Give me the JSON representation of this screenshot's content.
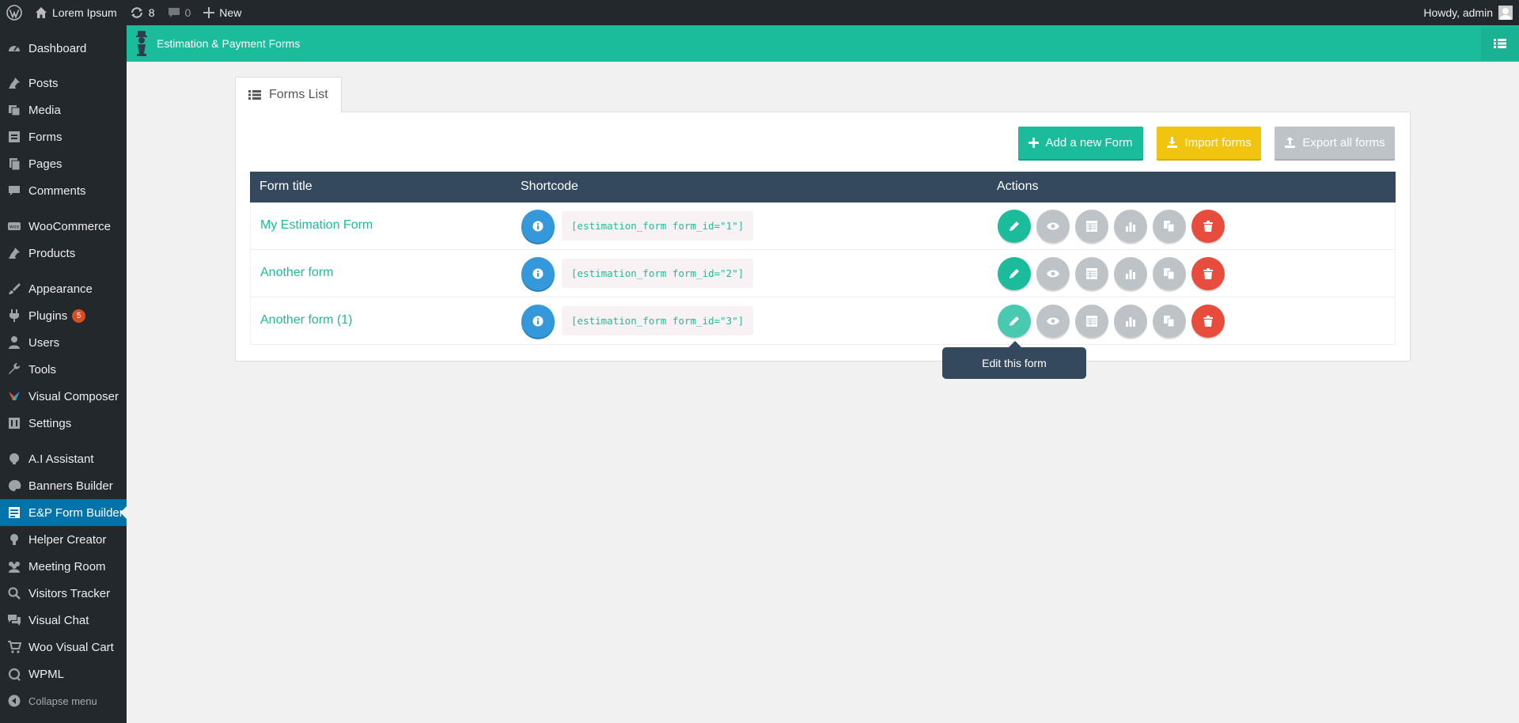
{
  "adminbar": {
    "site_name": "Lorem Ipsum",
    "updates_count": "8",
    "comments_count": "0",
    "new_label": "New",
    "howdy": "Howdy, admin"
  },
  "sidebar": {
    "items": [
      {
        "label": "Dashboard",
        "icon": "dashboard-icon"
      },
      {
        "label": "Posts",
        "icon": "pin-icon"
      },
      {
        "label": "Media",
        "icon": "media-icon"
      },
      {
        "label": "Forms",
        "icon": "forms-icon"
      },
      {
        "label": "Pages",
        "icon": "pages-icon"
      },
      {
        "label": "Comments",
        "icon": "comment-icon"
      },
      {
        "label": "WooCommerce",
        "icon": "woo-icon"
      },
      {
        "label": "Products",
        "icon": "pin-icon"
      },
      {
        "label": "Appearance",
        "icon": "brush-icon"
      },
      {
        "label": "Plugins",
        "icon": "plug-icon",
        "badge": "5"
      },
      {
        "label": "Users",
        "icon": "user-icon"
      },
      {
        "label": "Tools",
        "icon": "wrench-icon"
      },
      {
        "label": "Visual Composer",
        "icon": "vc-icon"
      },
      {
        "label": "Settings",
        "icon": "settings-icon"
      },
      {
        "label": "A.I Assistant",
        "icon": "assistant-icon"
      },
      {
        "label": "Banners Builder",
        "icon": "palette-icon"
      },
      {
        "label": "E&P Form Builder",
        "icon": "form-builder-icon"
      },
      {
        "label": "Helper Creator",
        "icon": "lightbulb-icon"
      },
      {
        "label": "Meeting Room",
        "icon": "group-icon"
      },
      {
        "label": "Visitors Tracker",
        "icon": "search-icon"
      },
      {
        "label": "Visual Chat",
        "icon": "chat-icon"
      },
      {
        "label": "Woo Visual Cart",
        "icon": "cart-icon"
      },
      {
        "label": "WPML",
        "icon": "wpml-icon"
      }
    ],
    "collapse_label": "Collapse menu"
  },
  "plugin": {
    "title": "Estimation & Payment Forms"
  },
  "tab": {
    "label": "Forms List"
  },
  "toolbar": {
    "add_label": "Add a new Form",
    "import_label": "Import forms",
    "export_label": "Export all forms"
  },
  "table": {
    "headers": [
      "Form title",
      "Shortcode",
      "Actions"
    ],
    "rows": [
      {
        "title": "My Estimation Form",
        "shortcode": "[estimation_form form_id=\"1\"]"
      },
      {
        "title": "Another form",
        "shortcode": "[estimation_form form_id=\"2\"]"
      },
      {
        "title": "Another form (1)",
        "shortcode": "[estimation_form form_id=\"3\"]"
      }
    ]
  },
  "tooltip": {
    "text": "Edit this form"
  },
  "colors": {
    "accent": "#1abc9c",
    "header": "#34495e",
    "info": "#3498db",
    "import": "#f1c40f",
    "danger": "#e74c3c",
    "muted": "#bdc3c7",
    "sidebar": "#23282d",
    "active": "#0073aa"
  }
}
